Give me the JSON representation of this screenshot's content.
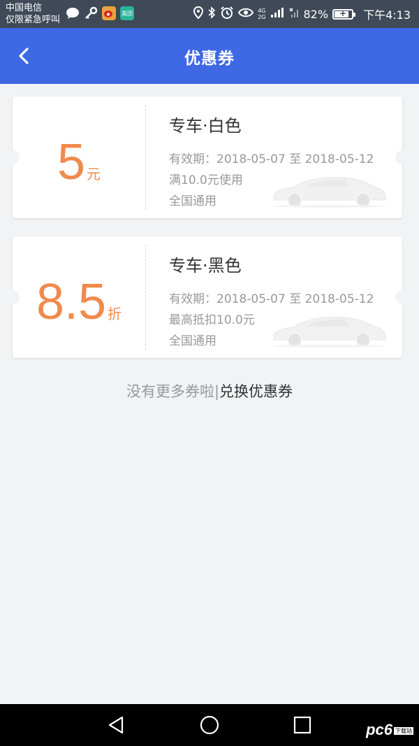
{
  "status_bar": {
    "carrier_line1": "中国电信",
    "carrier_line2": "仅限紧急呼叫",
    "left_icons": [
      "chat-bubble-icon",
      "key-icon",
      "weibo-icon",
      "meituan-icon"
    ],
    "meituan_label": "美团",
    "network_top": "4G",
    "network_bottom": "2G",
    "battery": "82%",
    "battery_level": 0.82,
    "time": "下午4:13"
  },
  "header": {
    "title": "优惠券"
  },
  "coupons": [
    {
      "amount": "5",
      "unit": "元",
      "title": "专车·白色",
      "validity": "有效期：2018-05-07 至 2018-05-12",
      "condition": "满10.0元使用",
      "scope": "全国通用"
    },
    {
      "amount": "8.5",
      "unit": "折",
      "title": "专车·黑色",
      "validity": "有效期：2018-05-07 至 2018-05-12",
      "condition": "最高抵扣10.0元",
      "scope": "全国通用"
    }
  ],
  "footer": {
    "no_more": "没有更多券啦",
    "separator": "|",
    "exchange": "兑换优惠券"
  },
  "watermark": {
    "text": "pc6",
    "sub": "下载站"
  },
  "colors": {
    "header_bg": "#3e68e4",
    "amount": "#f08a4c",
    "status_bar_bg": "#3f4957"
  }
}
